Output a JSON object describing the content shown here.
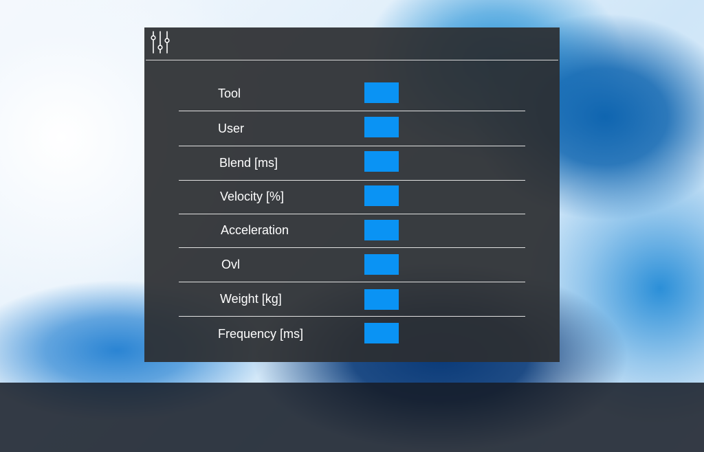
{
  "panel": {
    "header_icon": "sliders-icon",
    "value_color": "#0a93f4",
    "rows": [
      {
        "label": "Tool"
      },
      {
        "label": "User"
      },
      {
        "label": "Blend [ms]"
      },
      {
        "label": "Velocity [%]"
      },
      {
        "label": "Acceleration"
      },
      {
        "label": "Ovl"
      },
      {
        "label": "Weight [kg]"
      },
      {
        "label": "Frequency [ms]"
      }
    ]
  }
}
